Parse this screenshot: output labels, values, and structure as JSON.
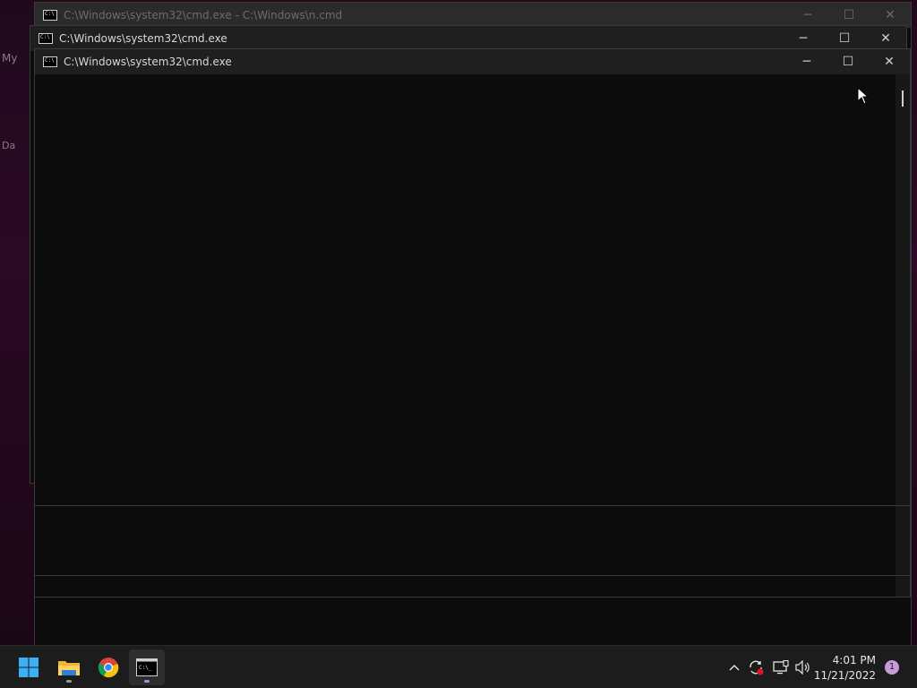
{
  "desktop": {
    "left_text_1": "My",
    "left_text_2": "Da"
  },
  "windows": {
    "back1": {
      "title": "C:\\Windows\\system32\\cmd.exe - C:\\Windows\\n.cmd"
    },
    "back2": {
      "title": "C:\\Windows\\system32\\cmd.exe"
    },
    "front": {
      "title": "C:\\Windows\\system32\\cmd.exe"
    },
    "controls": {
      "minimize": "─",
      "maximize": "☐",
      "close": "✕"
    }
  },
  "taskbar": {
    "apps": [
      {
        "name": "Start",
        "icon": "windows-logo-icon"
      },
      {
        "name": "File Explorer",
        "icon": "folder-icon"
      },
      {
        "name": "Google Chrome",
        "icon": "chrome-icon"
      },
      {
        "name": "Command Prompt",
        "icon": "terminal-icon"
      }
    ],
    "tray": {
      "chevron": "^",
      "time": "4:01 PM",
      "date": "11/21/2022",
      "notification_count": "1"
    }
  },
  "colors": {
    "console_bg": "#0c0c0c",
    "titlebar_bg": "#1f1f1f",
    "taskbar_bg": "#1c1c1c",
    "accent": "#c79bd9"
  }
}
